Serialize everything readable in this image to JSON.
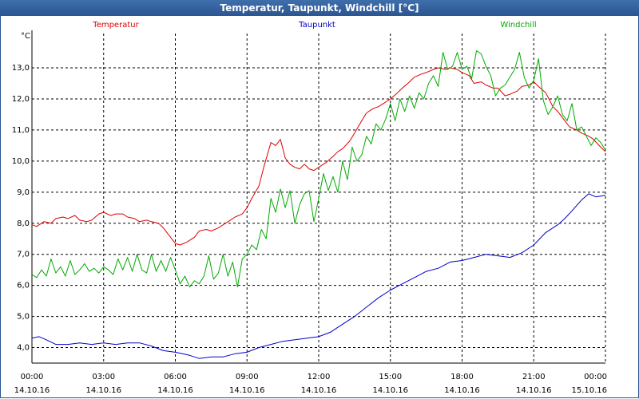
{
  "window": {
    "title": "Temperatur, Taupunkt, Windchill [°C]"
  },
  "chart_data": {
    "type": "line",
    "title": "Temperatur, Taupunkt, Windchill [°C]",
    "y_unit": "°C",
    "ylim": [
      3.5,
      13.9
    ],
    "xlim": [
      0,
      24
    ],
    "grid": true,
    "legend_placement": "top",
    "y_ticks": [
      4.0,
      5.0,
      6.0,
      7.0,
      8.0,
      9.0,
      10.0,
      11.0,
      12.0,
      13.0
    ],
    "y_tick_labels": [
      "4,0",
      "5,0",
      "6,0",
      "7,0",
      "8,0",
      "9,0",
      "10,0",
      "11,0",
      "12,0",
      "13,0"
    ],
    "x_ticks": [
      0,
      3,
      6,
      9,
      12,
      15,
      18,
      21,
      24
    ],
    "x_tick_labels": [
      [
        "00:00",
        "14.10.16"
      ],
      [
        "03:00",
        "14.10.16"
      ],
      [
        "06:00",
        "14.10.16"
      ],
      [
        "09:00",
        "14.10.16"
      ],
      [
        "12:00",
        "14.10.16"
      ],
      [
        "15:00",
        "14.10.16"
      ],
      [
        "18:00",
        "14.10.16"
      ],
      [
        "21:00",
        "14.10.16"
      ],
      [
        "00:00",
        "15.10.16"
      ]
    ],
    "series": [
      {
        "name": "Temperatur",
        "color": "#dd0000",
        "points": [
          [
            0,
            7.95
          ],
          [
            0.2,
            7.9
          ],
          [
            0.5,
            8.05
          ],
          [
            0.8,
            8.0
          ],
          [
            1.0,
            8.15
          ],
          [
            1.3,
            8.2
          ],
          [
            1.5,
            8.15
          ],
          [
            1.8,
            8.25
          ],
          [
            2.0,
            8.1
          ],
          [
            2.3,
            8.05
          ],
          [
            2.5,
            8.1
          ],
          [
            2.8,
            8.3
          ],
          [
            3.0,
            8.35
          ],
          [
            3.3,
            8.25
          ],
          [
            3.5,
            8.3
          ],
          [
            3.8,
            8.3
          ],
          [
            4.0,
            8.2
          ],
          [
            4.3,
            8.15
          ],
          [
            4.5,
            8.05
          ],
          [
            4.8,
            8.1
          ],
          [
            5.0,
            8.05
          ],
          [
            5.3,
            8.0
          ],
          [
            5.5,
            7.85
          ],
          [
            5.8,
            7.55
          ],
          [
            6.0,
            7.35
          ],
          [
            6.2,
            7.3
          ],
          [
            6.5,
            7.4
          ],
          [
            6.8,
            7.55
          ],
          [
            7.0,
            7.75
          ],
          [
            7.3,
            7.8
          ],
          [
            7.5,
            7.75
          ],
          [
            7.8,
            7.85
          ],
          [
            8.0,
            7.95
          ],
          [
            8.3,
            8.1
          ],
          [
            8.5,
            8.2
          ],
          [
            8.8,
            8.3
          ],
          [
            9.0,
            8.5
          ],
          [
            9.2,
            8.8
          ],
          [
            9.5,
            9.2
          ],
          [
            9.7,
            9.8
          ],
          [
            10.0,
            10.6
          ],
          [
            10.2,
            10.5
          ],
          [
            10.4,
            10.7
          ],
          [
            10.6,
            10.1
          ],
          [
            10.8,
            9.9
          ],
          [
            11.0,
            9.8
          ],
          [
            11.2,
            9.75
          ],
          [
            11.4,
            9.9
          ],
          [
            11.6,
            9.75
          ],
          [
            11.8,
            9.7
          ],
          [
            12.0,
            9.8
          ],
          [
            12.3,
            9.95
          ],
          [
            12.6,
            10.15
          ],
          [
            12.8,
            10.3
          ],
          [
            13.0,
            10.4
          ],
          [
            13.3,
            10.65
          ],
          [
            13.5,
            10.9
          ],
          [
            13.8,
            11.3
          ],
          [
            14.0,
            11.55
          ],
          [
            14.3,
            11.7
          ],
          [
            14.5,
            11.75
          ],
          [
            14.8,
            11.9
          ],
          [
            15.0,
            12.0
          ],
          [
            15.3,
            12.2
          ],
          [
            15.5,
            12.35
          ],
          [
            15.8,
            12.55
          ],
          [
            16.0,
            12.7
          ],
          [
            16.3,
            12.8
          ],
          [
            16.5,
            12.85
          ],
          [
            16.8,
            12.95
          ],
          [
            17.0,
            13.0
          ],
          [
            17.3,
            12.95
          ],
          [
            17.5,
            13.0
          ],
          [
            17.8,
            12.95
          ],
          [
            18.0,
            12.85
          ],
          [
            18.3,
            12.75
          ],
          [
            18.5,
            12.5
          ],
          [
            18.8,
            12.55
          ],
          [
            19.0,
            12.45
          ],
          [
            19.3,
            12.35
          ],
          [
            19.5,
            12.35
          ],
          [
            19.8,
            12.1
          ],
          [
            20.0,
            12.15
          ],
          [
            20.3,
            12.25
          ],
          [
            20.5,
            12.4
          ],
          [
            20.8,
            12.45
          ],
          [
            21.0,
            12.55
          ],
          [
            21.2,
            12.4
          ],
          [
            21.5,
            12.2
          ],
          [
            21.8,
            11.75
          ],
          [
            22.0,
            11.6
          ],
          [
            22.3,
            11.3
          ],
          [
            22.5,
            11.1
          ],
          [
            22.8,
            11.0
          ],
          [
            23.0,
            10.9
          ],
          [
            23.3,
            10.8
          ],
          [
            23.5,
            10.7
          ],
          [
            23.8,
            10.45
          ],
          [
            24.0,
            10.3
          ]
        ]
      },
      {
        "name": "Taupunkt",
        "color": "#0000cc",
        "points": [
          [
            0,
            4.3
          ],
          [
            0.3,
            4.35
          ],
          [
            0.6,
            4.25
          ],
          [
            1.0,
            4.1
          ],
          [
            1.5,
            4.1
          ],
          [
            2.0,
            4.15
          ],
          [
            2.5,
            4.1
          ],
          [
            3.0,
            4.15
          ],
          [
            3.5,
            4.1
          ],
          [
            4.0,
            4.15
          ],
          [
            4.5,
            4.15
          ],
          [
            5.0,
            4.05
          ],
          [
            5.5,
            3.9
          ],
          [
            6.0,
            3.85
          ],
          [
            6.3,
            3.8
          ],
          [
            6.6,
            3.75
          ],
          [
            7.0,
            3.65
          ],
          [
            7.5,
            3.7
          ],
          [
            8.0,
            3.7
          ],
          [
            8.5,
            3.8
          ],
          [
            9.0,
            3.85
          ],
          [
            9.5,
            4.0
          ],
          [
            10.0,
            4.1
          ],
          [
            10.5,
            4.2
          ],
          [
            11.0,
            4.25
          ],
          [
            11.5,
            4.3
          ],
          [
            12.0,
            4.35
          ],
          [
            12.5,
            4.5
          ],
          [
            13.0,
            4.75
          ],
          [
            13.5,
            5.0
          ],
          [
            14.0,
            5.3
          ],
          [
            14.5,
            5.6
          ],
          [
            15.0,
            5.85
          ],
          [
            15.5,
            6.05
          ],
          [
            16.0,
            6.25
          ],
          [
            16.5,
            6.45
          ],
          [
            17.0,
            6.55
          ],
          [
            17.5,
            6.75
          ],
          [
            18.0,
            6.8
          ],
          [
            18.5,
            6.9
          ],
          [
            19.0,
            7.0
          ],
          [
            19.5,
            6.95
          ],
          [
            20.0,
            6.9
          ],
          [
            20.5,
            7.05
          ],
          [
            21.0,
            7.3
          ],
          [
            21.5,
            7.7
          ],
          [
            22.0,
            7.95
          ],
          [
            22.3,
            8.15
          ],
          [
            22.6,
            8.4
          ],
          [
            23.0,
            8.75
          ],
          [
            23.3,
            8.95
          ],
          [
            23.6,
            8.85
          ],
          [
            24.0,
            8.9
          ]
        ]
      },
      {
        "name": "Windchill",
        "color": "#00aa00",
        "points": [
          [
            0,
            6.35
          ],
          [
            0.2,
            6.25
          ],
          [
            0.4,
            6.5
          ],
          [
            0.6,
            6.3
          ],
          [
            0.8,
            6.85
          ],
          [
            1.0,
            6.4
          ],
          [
            1.2,
            6.6
          ],
          [
            1.4,
            6.3
          ],
          [
            1.6,
            6.8
          ],
          [
            1.8,
            6.35
          ],
          [
            2.0,
            6.5
          ],
          [
            2.2,
            6.7
          ],
          [
            2.4,
            6.45
          ],
          [
            2.6,
            6.55
          ],
          [
            2.8,
            6.4
          ],
          [
            3.0,
            6.6
          ],
          [
            3.2,
            6.5
          ],
          [
            3.4,
            6.35
          ],
          [
            3.6,
            6.85
          ],
          [
            3.8,
            6.5
          ],
          [
            4.0,
            6.9
          ],
          [
            4.2,
            6.45
          ],
          [
            4.4,
            7.0
          ],
          [
            4.6,
            6.5
          ],
          [
            4.8,
            6.4
          ],
          [
            5.0,
            7.0
          ],
          [
            5.2,
            6.45
          ],
          [
            5.4,
            6.8
          ],
          [
            5.6,
            6.45
          ],
          [
            5.8,
            6.9
          ],
          [
            6.0,
            6.5
          ],
          [
            6.2,
            6.05
          ],
          [
            6.4,
            6.3
          ],
          [
            6.6,
            5.95
          ],
          [
            6.8,
            6.15
          ],
          [
            7.0,
            6.05
          ],
          [
            7.2,
            6.3
          ],
          [
            7.4,
            6.95
          ],
          [
            7.6,
            6.2
          ],
          [
            7.8,
            6.4
          ],
          [
            8.0,
            7.0
          ],
          [
            8.2,
            6.3
          ],
          [
            8.4,
            6.75
          ],
          [
            8.6,
            5.95
          ],
          [
            8.8,
            6.85
          ],
          [
            9.0,
            7.0
          ],
          [
            9.2,
            7.3
          ],
          [
            9.4,
            7.15
          ],
          [
            9.6,
            7.8
          ],
          [
            9.8,
            7.5
          ],
          [
            10.0,
            8.8
          ],
          [
            10.2,
            8.35
          ],
          [
            10.4,
            9.1
          ],
          [
            10.6,
            8.5
          ],
          [
            10.8,
            9.05
          ],
          [
            11.0,
            8.0
          ],
          [
            11.2,
            8.6
          ],
          [
            11.4,
            8.95
          ],
          [
            11.6,
            9.05
          ],
          [
            11.8,
            8.05
          ],
          [
            12.0,
            8.8
          ],
          [
            12.2,
            9.6
          ],
          [
            12.4,
            9.05
          ],
          [
            12.6,
            9.5
          ],
          [
            12.8,
            9.0
          ],
          [
            13.0,
            10.0
          ],
          [
            13.2,
            9.4
          ],
          [
            13.4,
            10.45
          ],
          [
            13.6,
            10.0
          ],
          [
            13.8,
            10.2
          ],
          [
            14.0,
            10.8
          ],
          [
            14.2,
            10.55
          ],
          [
            14.4,
            11.2
          ],
          [
            14.6,
            11.0
          ],
          [
            14.8,
            11.35
          ],
          [
            15.0,
            11.85
          ],
          [
            15.2,
            11.3
          ],
          [
            15.4,
            12.0
          ],
          [
            15.6,
            11.6
          ],
          [
            15.8,
            12.1
          ],
          [
            16.0,
            11.7
          ],
          [
            16.2,
            12.2
          ],
          [
            16.4,
            12.0
          ],
          [
            16.6,
            12.5
          ],
          [
            16.8,
            12.75
          ],
          [
            17.0,
            12.4
          ],
          [
            17.2,
            13.5
          ],
          [
            17.4,
            12.95
          ],
          [
            17.6,
            13.05
          ],
          [
            17.8,
            13.5
          ],
          [
            18.0,
            12.95
          ],
          [
            18.2,
            13.05
          ],
          [
            18.4,
            12.65
          ],
          [
            18.6,
            13.55
          ],
          [
            18.8,
            13.45
          ],
          [
            19.0,
            13.05
          ],
          [
            19.2,
            12.75
          ],
          [
            19.4,
            12.1
          ],
          [
            19.6,
            12.35
          ],
          [
            19.8,
            12.45
          ],
          [
            20.0,
            12.7
          ],
          [
            20.2,
            12.95
          ],
          [
            20.4,
            13.5
          ],
          [
            20.6,
            12.7
          ],
          [
            20.8,
            12.35
          ],
          [
            21.0,
            12.6
          ],
          [
            21.2,
            13.3
          ],
          [
            21.4,
            11.95
          ],
          [
            21.6,
            11.5
          ],
          [
            21.8,
            11.75
          ],
          [
            22.0,
            12.1
          ],
          [
            22.2,
            11.5
          ],
          [
            22.4,
            11.3
          ],
          [
            22.6,
            11.85
          ],
          [
            22.8,
            11.0
          ],
          [
            23.0,
            11.1
          ],
          [
            23.2,
            10.8
          ],
          [
            23.4,
            10.5
          ],
          [
            23.6,
            10.75
          ],
          [
            23.8,
            10.6
          ],
          [
            24.0,
            10.35
          ]
        ]
      }
    ]
  }
}
